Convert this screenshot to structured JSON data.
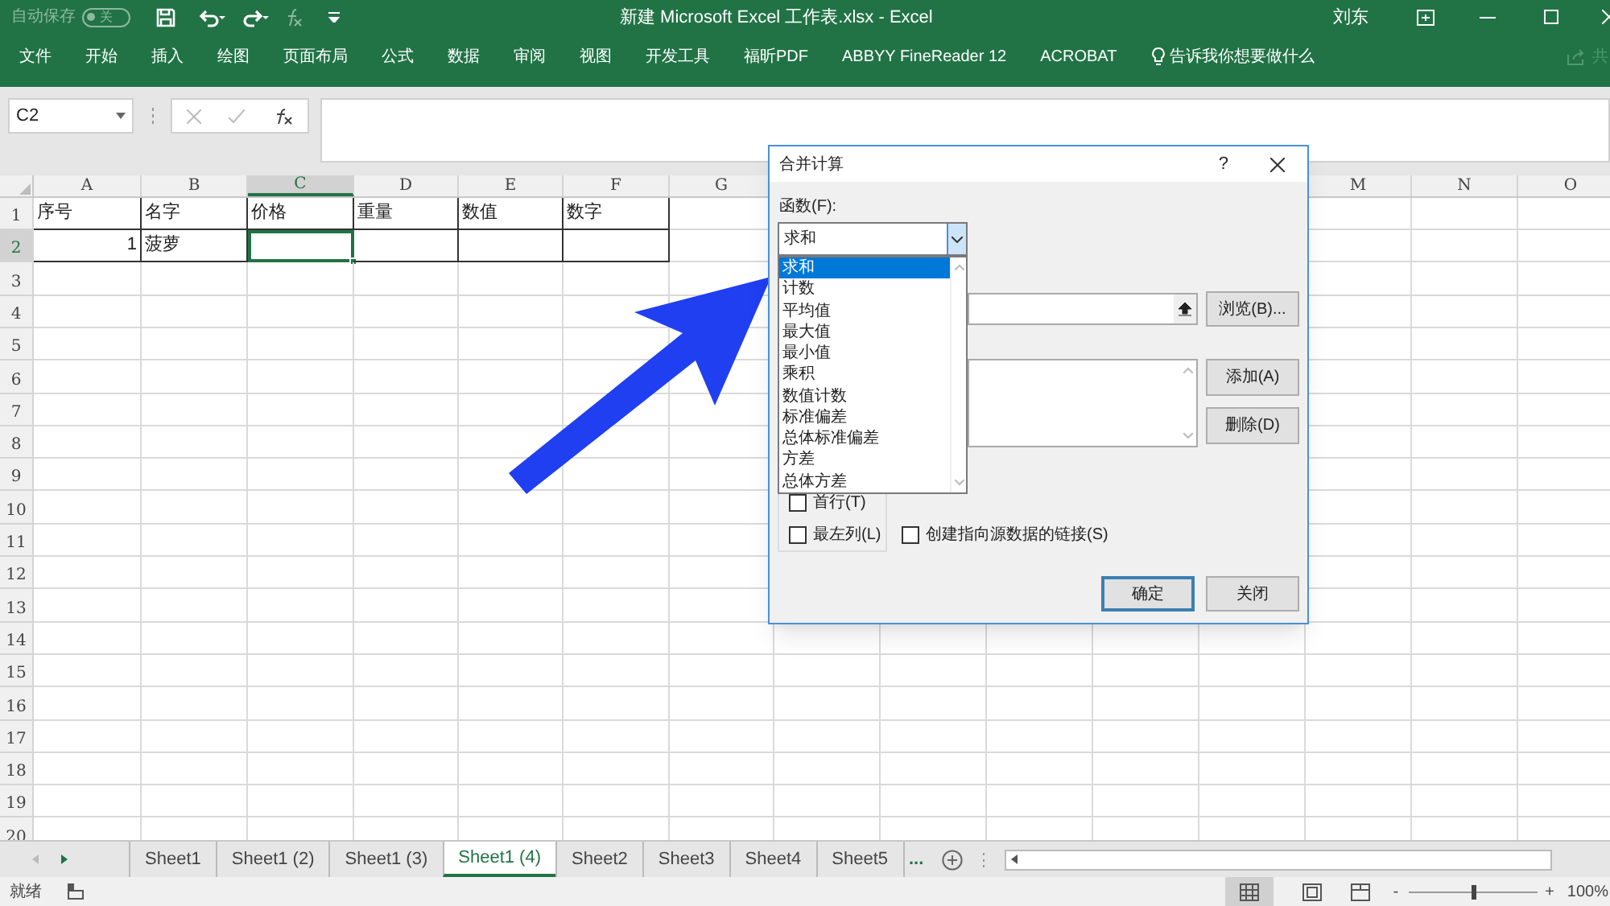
{
  "title_bar": {
    "autosave": {
      "label": "自动保存",
      "on": false,
      "state_text": "关"
    },
    "title": "新建 Microsoft Excel 工作表.xlsx  -  Excel",
    "user": "刘东"
  },
  "ribbon": {
    "tabs": [
      "文件",
      "开始",
      "插入",
      "绘图",
      "页面布局",
      "公式",
      "数据",
      "审阅",
      "视图",
      "开发工具",
      "福昕PDF",
      "ABBYY FineReader 12",
      "ACROBAT"
    ],
    "tell_me": "告诉我你想要做什么",
    "share": "共"
  },
  "formula_bar": {
    "name_box": "C2"
  },
  "sheet": {
    "columns": [
      "A",
      "B",
      "C",
      "D",
      "E",
      "F",
      "G",
      "M",
      "N",
      "O"
    ],
    "rows": [
      {
        "label": "1",
        "cells": [
          {
            "text": "序号",
            "selected": false
          },
          {
            "text": "名字",
            "selected": false
          },
          {
            "text": "价格",
            "selected": false
          },
          {
            "text": "重量",
            "selected": false
          },
          {
            "text": "数值",
            "selected": false
          },
          {
            "text": "数字",
            "selected": false
          }
        ]
      },
      {
        "label": "2",
        "cells": [
          {
            "text": "1",
            "align_right": true,
            "selected": false
          },
          {
            "text": "菠萝",
            "selected": false
          },
          {
            "text": "",
            "selected": true
          },
          {
            "text": "",
            "selected": false
          },
          {
            "text": "",
            "selected": false
          },
          {
            "text": "",
            "selected": false
          }
        ]
      },
      {
        "label": "3"
      },
      {
        "label": "4"
      },
      {
        "label": "5"
      },
      {
        "label": "6"
      },
      {
        "label": "7"
      },
      {
        "label": "8"
      },
      {
        "label": "9"
      },
      {
        "label": "10"
      },
      {
        "label": "11"
      },
      {
        "label": "12"
      },
      {
        "label": "13"
      },
      {
        "label": "14"
      },
      {
        "label": "15"
      },
      {
        "label": "16"
      },
      {
        "label": "17"
      },
      {
        "label": "18"
      },
      {
        "label": "19"
      },
      {
        "label": "20"
      }
    ]
  },
  "dialog": {
    "title": "合并计算",
    "help": "?",
    "function_label": "函数(F):",
    "function_value": "求和",
    "function_options": [
      {
        "label": "求和",
        "selected": true
      },
      {
        "label": "计数",
        "selected": false
      },
      {
        "label": "平均值",
        "selected": false
      },
      {
        "label": "最大值",
        "selected": false
      },
      {
        "label": "最小值",
        "selected": false
      },
      {
        "label": "乘积",
        "selected": false
      },
      {
        "label": "数值计数",
        "selected": false
      },
      {
        "label": "标准偏差",
        "selected": false
      },
      {
        "label": "总体标准偏差",
        "selected": false
      },
      {
        "label": "方差",
        "selected": false
      },
      {
        "label": "总体方差",
        "selected": false
      }
    ],
    "browse": "浏览(B)...",
    "add": "添加(A)",
    "delete": "删除(D)",
    "checkboxes": [
      {
        "label": "首行(T)",
        "checked": false
      },
      {
        "label": "最左列(L)",
        "checked": false
      },
      {
        "label": "创建指向源数据的链接(S)",
        "checked": false
      }
    ],
    "ok": "确定",
    "close": "关闭"
  },
  "sheet_tabs": [
    {
      "label": "Sheet1",
      "selected": false
    },
    {
      "label": "Sheet1 (2)",
      "selected": false
    },
    {
      "label": "Sheet1 (3)",
      "selected": false
    },
    {
      "label": "Sheet1 (4)",
      "selected": true
    },
    {
      "label": "Sheet2",
      "selected": false
    },
    {
      "label": "Sheet3",
      "selected": false
    },
    {
      "label": "Sheet4",
      "selected": false
    },
    {
      "label": "Sheet5",
      "selected": false
    }
  ],
  "more_tabs": "...",
  "status_bar": {
    "status": "就绪",
    "zoom_out": "-",
    "level": 0.5,
    "zoom_in": "+",
    "zoom": "100%"
  }
}
